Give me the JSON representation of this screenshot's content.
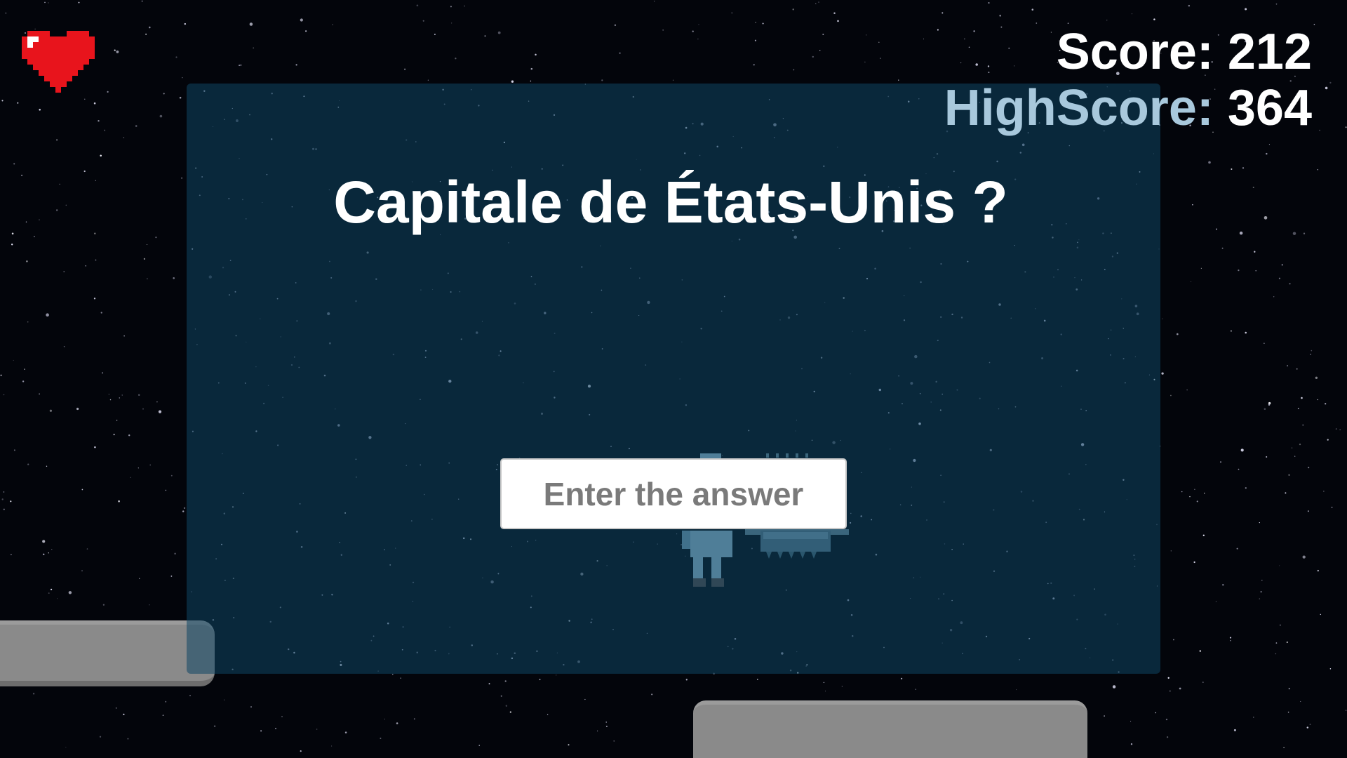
{
  "hud": {
    "lives": 1,
    "score_label": "Score: ",
    "score_value": "212",
    "highscore_label": "HighScore: ",
    "highscore_value": "364"
  },
  "quiz": {
    "question": "Capitale de États-Unis ?",
    "answer_placeholder": "Enter the answer",
    "answer_value": ""
  },
  "icons": {
    "heart": "heart-icon",
    "player": "robot-astronaut",
    "enemy": "spiked-drone"
  },
  "colors": {
    "background": "#03050b",
    "panel": "#0e4664",
    "heart": "#e8141c",
    "highscore_label": "#a8c8dc",
    "platform": "#8a8a8a"
  }
}
